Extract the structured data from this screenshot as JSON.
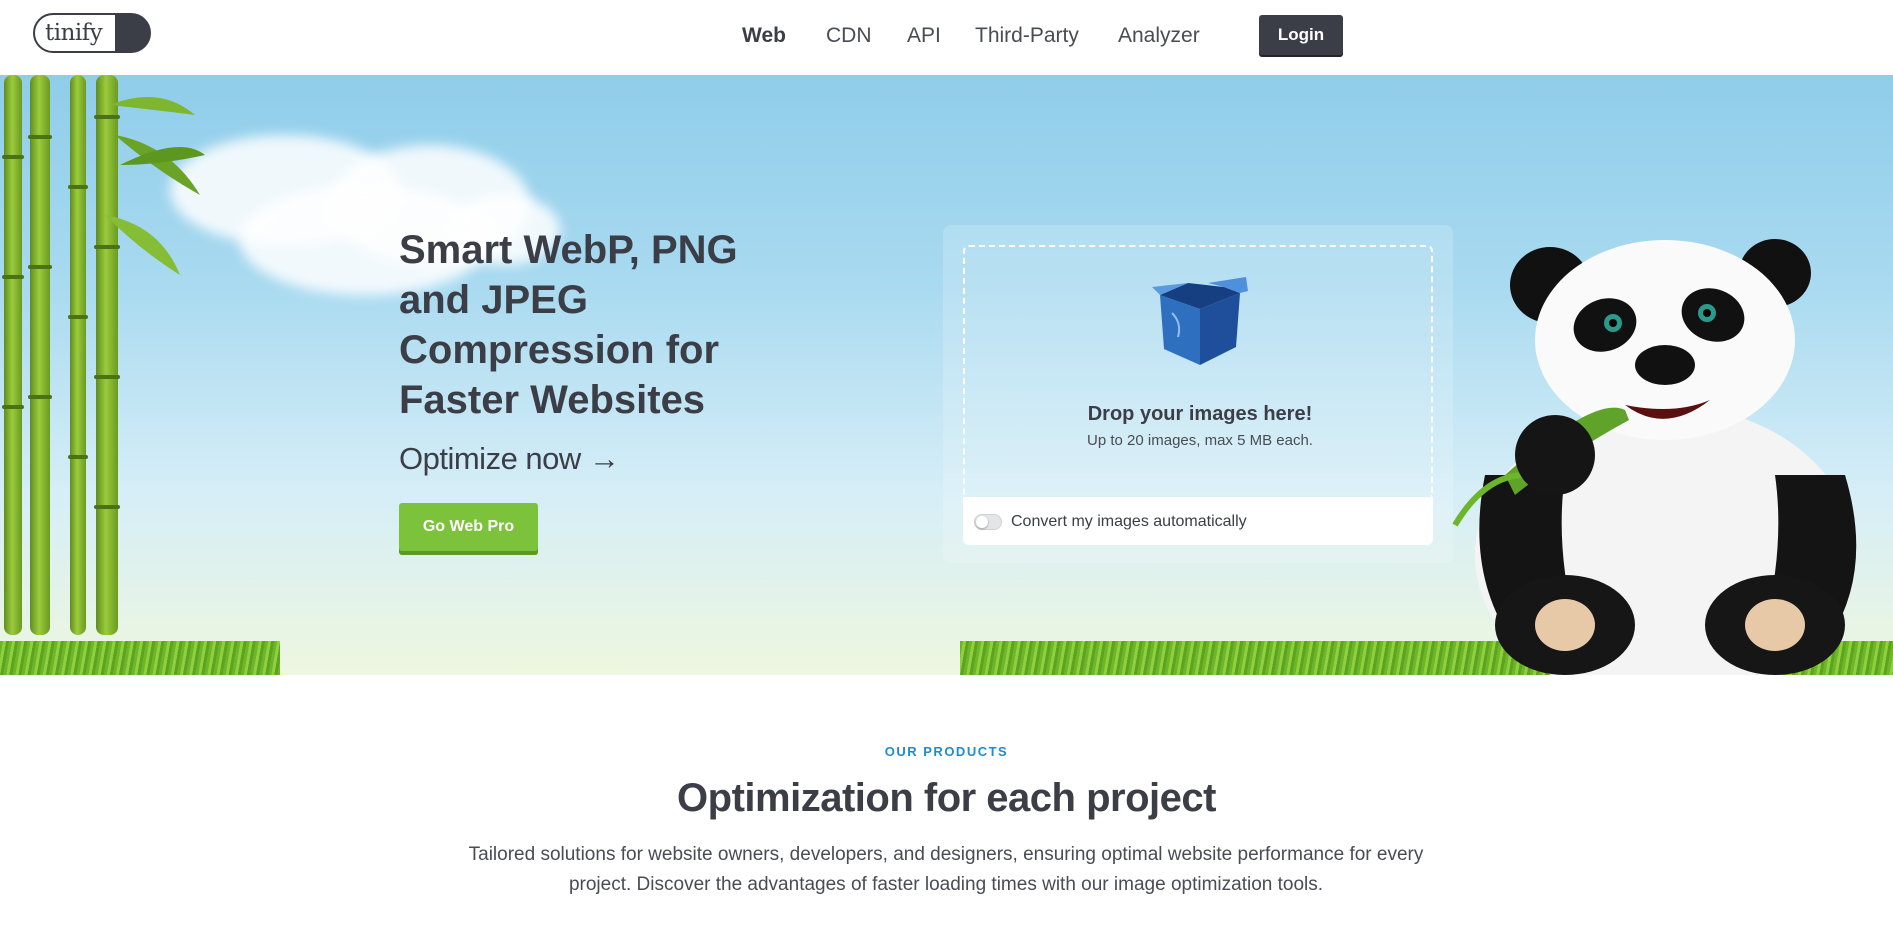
{
  "header": {
    "logo_text": "tinify",
    "nav": [
      {
        "label": "Web",
        "active": true
      },
      {
        "label": "CDN"
      },
      {
        "label": "API"
      },
      {
        "label": "Third-Party"
      },
      {
        "label": "Analyzer"
      }
    ],
    "login_label": "Login"
  },
  "hero": {
    "title": "Smart WebP, PNG and JPEG Compression for Faster Websites",
    "optimize_link": "Optimize now",
    "optimize_arrow": "→",
    "pro_button": "Go Web Pro",
    "dropzone": {
      "title": "Drop your images here!",
      "subtitle": "Up to 20 images, max 5 MB each.",
      "convert_label": "Convert my images automatically",
      "convert_enabled": false
    }
  },
  "products": {
    "eyebrow": "OUR PRODUCTS",
    "title": "Optimization for each project",
    "description": "Tailored solutions for website owners, developers, and designers, ensuring optimal website performance for every project. Discover the advantages of faster loading times with our image optimization tools."
  },
  "icons": {
    "dropzone": "box-icon",
    "mascot": "panda-illustration",
    "toggle": "toggle-switch"
  },
  "colors": {
    "brand_dark": "#3c3e47",
    "accent_green": "#7cc23a",
    "eyebrow_blue": "#1f8bd1"
  }
}
